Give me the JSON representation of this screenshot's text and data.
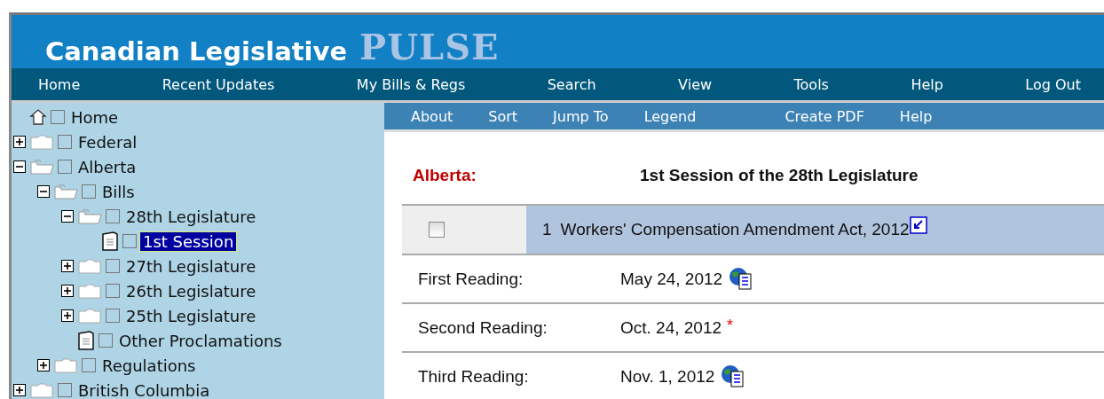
{
  "header": {
    "title": "Canadian Legislative",
    "brand": "PULSE"
  },
  "main_nav": [
    "Home",
    "Recent Updates",
    "My Bills & Regs",
    "Search",
    "View",
    "Tools",
    "Help",
    "Log Out"
  ],
  "sub_nav": [
    "About",
    "Sort",
    "Jump To",
    "Legend",
    "Create PDF",
    "Help"
  ],
  "tree": [
    {
      "label": "Home",
      "kind": "home",
      "checked": false,
      "selected": false
    },
    {
      "label": "Federal",
      "kind": "folder",
      "expanded": false,
      "checked": false,
      "selected": false
    },
    {
      "label": "Alberta",
      "kind": "folder",
      "expanded": true,
      "checked": false,
      "selected": false,
      "children": [
        {
          "label": "Bills",
          "kind": "folder",
          "expanded": true,
          "checked": false,
          "selected": false,
          "children": [
            {
              "label": "28th Legislature",
              "kind": "folder",
              "expanded": true,
              "checked": false,
              "selected": false,
              "children": [
                {
                  "label": "1st Session",
                  "kind": "document",
                  "checked": false,
                  "selected": true
                }
              ]
            },
            {
              "label": "27th Legislature",
              "kind": "folder",
              "expanded": false,
              "checked": false,
              "selected": false
            },
            {
              "label": "26th Legislature",
              "kind": "folder",
              "expanded": false,
              "checked": false,
              "selected": false
            },
            {
              "label": "25th Legislature",
              "kind": "folder",
              "expanded": false,
              "checked": false,
              "selected": false
            },
            {
              "label": "Other Proclamations",
              "kind": "document",
              "checked": false,
              "selected": false
            }
          ]
        },
        {
          "label": "Regulations",
          "kind": "folder",
          "expanded": false,
          "checked": false,
          "selected": false
        }
      ]
    },
    {
      "label": "British Columbia",
      "kind": "folder",
      "expanded": false,
      "checked": false,
      "selected": false
    }
  ],
  "content": {
    "jurisdiction": "Alberta:",
    "heading": "1st Session of the 28th Legislature",
    "bill": {
      "checked": false,
      "number": "1",
      "title": "Workers' Compensation Amendment Act, 2012"
    },
    "readings": [
      {
        "label": "First Reading:",
        "date": "May 24, 2012",
        "kind": "document-link"
      },
      {
        "label": "Second Reading:",
        "date": "Oct. 24, 2012",
        "kind": "note",
        "note": "*"
      },
      {
        "label": "Third Reading:",
        "date": "Nov. 1, 2012",
        "kind": "document-link"
      }
    ]
  }
}
